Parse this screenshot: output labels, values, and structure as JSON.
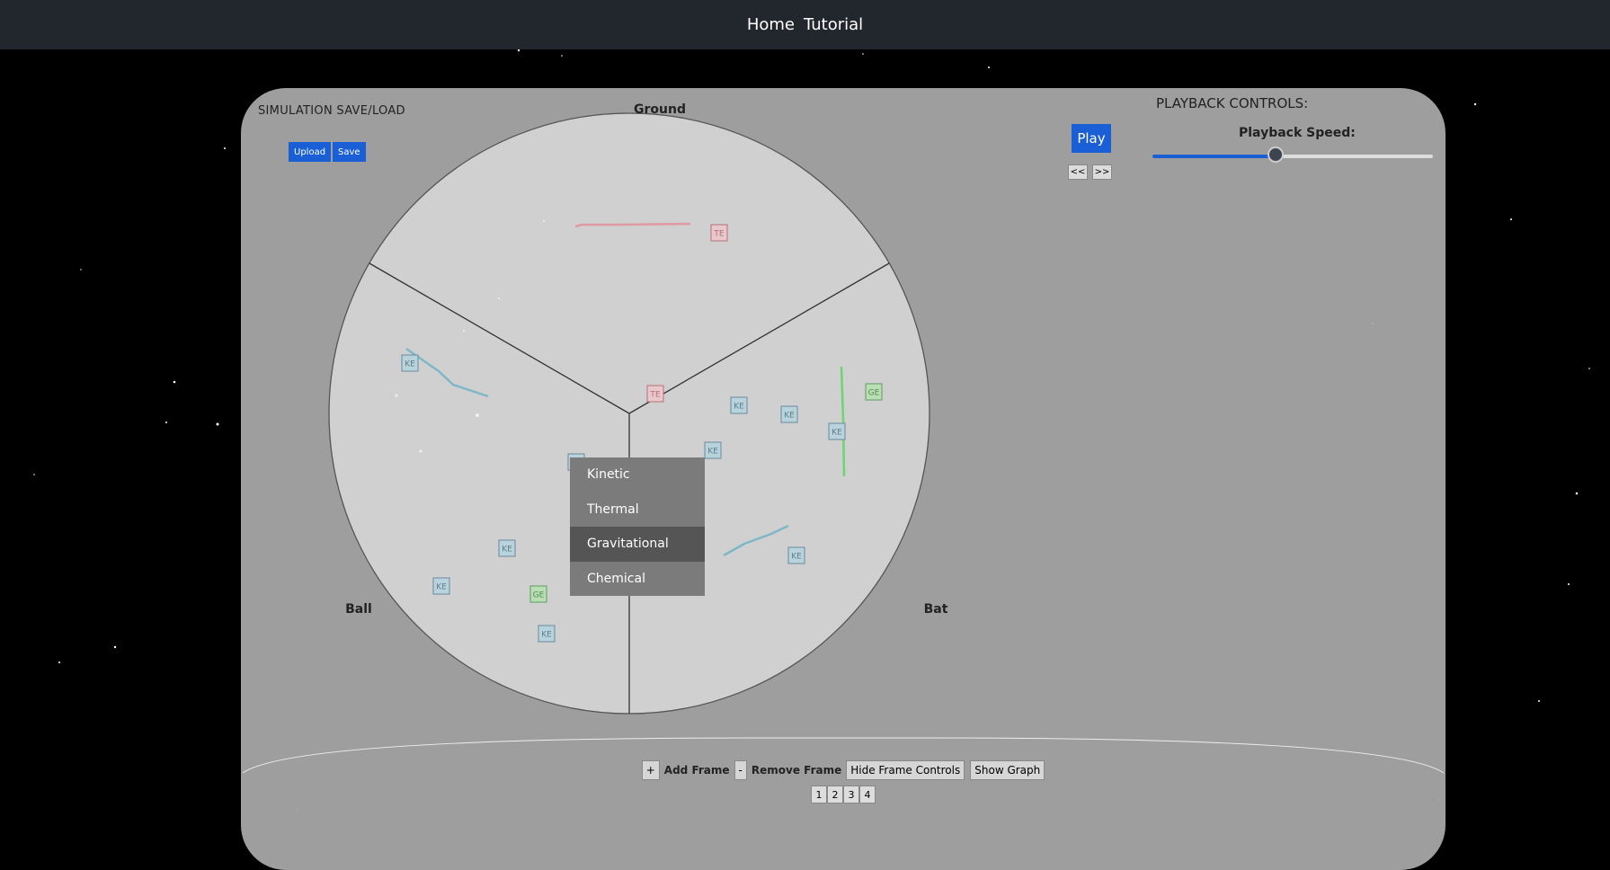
{
  "nav": {
    "home": "Home",
    "tutorial": "Tutorial"
  },
  "save_load": {
    "title": "SIMULATION SAVE/LOAD",
    "upload": "Upload",
    "save": "Save"
  },
  "playback": {
    "title": "PLAYBACK CONTROLS:",
    "play": "Play",
    "prev": "<<",
    "next": ">>",
    "speed_label": "Playback Speed:",
    "speed_fraction": 0.44
  },
  "diagram": {
    "ground_label": "Ground",
    "ball_label": "Ball",
    "bat_label": "Bat"
  },
  "energy_boxes": [
    {
      "label": "TE",
      "type": "thermal"
    },
    {
      "label": "TE",
      "type": "thermal"
    },
    {
      "label": "KE",
      "type": "kinetic"
    },
    {
      "label": "KE",
      "type": "kinetic"
    },
    {
      "label": "KE",
      "type": "kinetic"
    },
    {
      "label": "KE",
      "type": "kinetic"
    },
    {
      "label": "KE",
      "type": "kinetic"
    },
    {
      "label": "KE",
      "type": "kinetic"
    },
    {
      "label": "KE",
      "type": "kinetic"
    },
    {
      "label": "KE",
      "type": "kinetic"
    },
    {
      "label": "KE",
      "type": "kinetic"
    },
    {
      "label": "GE",
      "type": "gravitational"
    },
    {
      "label": "GE",
      "type": "gravitational"
    }
  ],
  "colors": {
    "thermal_border": "#b86f78",
    "thermal_fill": "#e8c8cb",
    "thermal_text": "#b86f78",
    "kinetic_border": "#6a8a9a",
    "kinetic_fill": "#b9d3dd",
    "kinetic_text": "#5b7e8d",
    "grav_border": "#5e9a5e",
    "grav_fill": "#b9deb4",
    "grav_text": "#4f8d4f",
    "accent": "#1a5fd6"
  },
  "context_menu": [
    "Kinetic",
    "Thermal",
    "Gravitational",
    "Chemical"
  ],
  "context_menu_active": 2,
  "frames": {
    "add": "+",
    "add_label": "Add Frame",
    "remove": "-",
    "remove_label": "Remove Frame",
    "hide": "Hide Frame Controls",
    "graph": "Show Graph",
    "pages": [
      "1",
      "2",
      "3",
      "4"
    ]
  }
}
